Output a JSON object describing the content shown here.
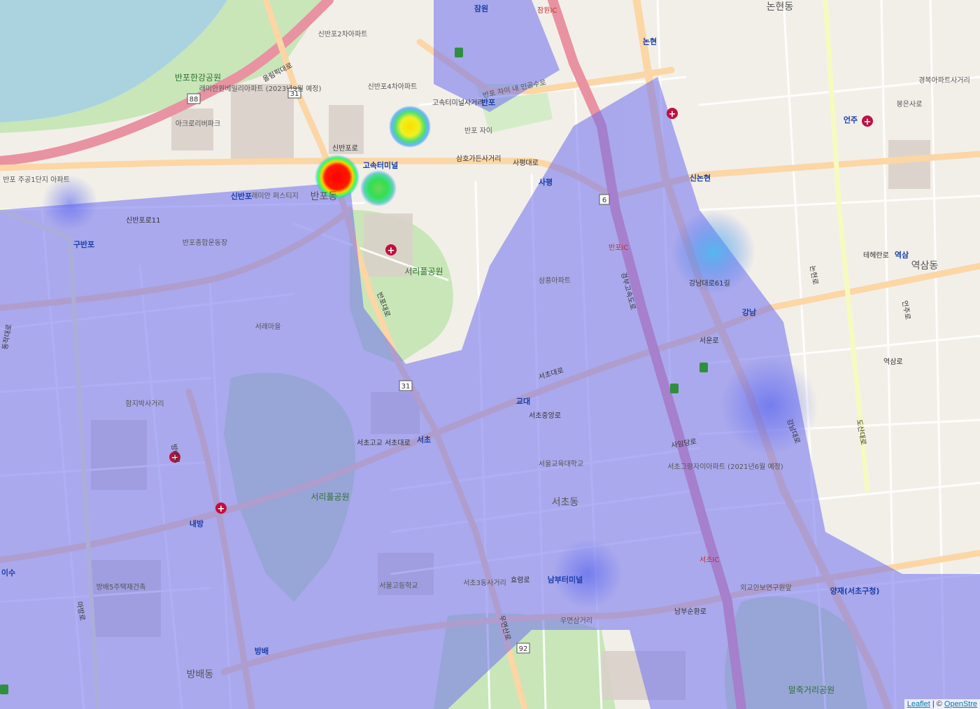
{
  "map": {
    "attribution": {
      "leaflet": "Leaflet",
      "sep": " | © ",
      "osm": "OpenStre"
    },
    "colors": {
      "land": "#f2efe9",
      "water": "#aad3df",
      "park": "#c8e6b8",
      "motorway": "#e892a2",
      "primary": "#fcd6a4",
      "heat_base": "#6f6ff0"
    },
    "area_labels": [
      {
        "id": "banpo-dong",
        "text": "반포동"
      },
      {
        "id": "seocho-dong",
        "text": "서초동"
      },
      {
        "id": "bangbae-dong",
        "text": "방배동"
      },
      {
        "id": "yeoksam-dong",
        "text": "역삼동"
      },
      {
        "id": "nonhyeon-dong",
        "text": "논현동"
      },
      {
        "id": "seoripul-park",
        "text": "서리풀공원"
      },
      {
        "id": "seoripul-park-2",
        "text": "서리풀공원"
      },
      {
        "id": "maljuk-park",
        "text": "말죽거리공원"
      },
      {
        "id": "banpo-hangang-park",
        "text": "반포한강공원"
      },
      {
        "id": "seoul-edu-univ",
        "text": "서울교육대학교"
      }
    ],
    "station_labels": [
      {
        "id": "gosok",
        "text": "고속터미널"
      },
      {
        "id": "sinbanpo",
        "text": "신반포"
      },
      {
        "id": "gubanpo",
        "text": "구반포"
      },
      {
        "id": "banpo",
        "text": "반포"
      },
      {
        "id": "sapyeong",
        "text": "사평"
      },
      {
        "id": "nonhyeon",
        "text": "논현"
      },
      {
        "id": "sinnonhyeon",
        "text": "신논현"
      },
      {
        "id": "gangnam",
        "text": "강남"
      },
      {
        "id": "gyodae",
        "text": "교대"
      },
      {
        "id": "seocho",
        "text": "서초"
      },
      {
        "id": "nambu",
        "text": "남부터미널"
      },
      {
        "id": "bangbae",
        "text": "방배"
      },
      {
        "id": "naebang",
        "text": "내방"
      },
      {
        "id": "isu",
        "text": "이수"
      },
      {
        "id": "eonju",
        "text": "언주"
      },
      {
        "id": "yeoksam",
        "text": "역삼"
      },
      {
        "id": "yangjae",
        "text": "양재(서초구청)"
      },
      {
        "id": "jamwon",
        "text": "잠원"
      }
    ],
    "road_labels": [
      {
        "id": "olympic",
        "text": "올림픽대로"
      },
      {
        "id": "sinbanpo-ro",
        "text": "신반포로"
      },
      {
        "id": "sapyeong-daero",
        "text": "사평대로"
      },
      {
        "id": "banpo-daero",
        "text": "반포대로"
      },
      {
        "id": "seocho-daero",
        "text": "서초대로"
      },
      {
        "id": "gangnam-daero",
        "text": "강남대로"
      },
      {
        "id": "teheran-ro",
        "text": "테헤란로"
      },
      {
        "id": "hyoryeong-ro",
        "text": "효령로"
      },
      {
        "id": "nambusunhwan-ro",
        "text": "남부순환로"
      },
      {
        "id": "bangbae-ro",
        "text": "방배로"
      },
      {
        "id": "gyeongbu",
        "text": "경부고속도로"
      },
      {
        "id": "seocho-jungang",
        "text": "서초중앙로"
      },
      {
        "id": "banpo-ic",
        "text": "반포IC"
      },
      {
        "id": "seocho-ic",
        "text": "서초IC"
      },
      {
        "id": "jamwon-ic",
        "text": "잠원IC"
      },
      {
        "id": "nonhyeon-ro",
        "text": "논현로"
      },
      {
        "id": "eonju-ro",
        "text": "언주로"
      },
      {
        "id": "dosan-daero",
        "text": "도산대로"
      },
      {
        "id": "yeoksam-ro",
        "text": "역삼로"
      },
      {
        "id": "sinbanpo-ro-11",
        "text": "신반포로11"
      },
      {
        "id": "dongjak-daero",
        "text": "동작대로"
      },
      {
        "id": "seoun-ro",
        "text": "서운로"
      },
      {
        "id": "sayeongdang-ro",
        "text": "사임당로"
      },
      {
        "id": "gangnam-daero-61",
        "text": "강남대로61길"
      },
      {
        "id": "seochogyo",
        "text": "서초고교 서초대로"
      },
      {
        "id": "samho",
        "text": "삼호가든사거리"
      },
      {
        "id": "gosok-cross",
        "text": "고속터미널사거리"
      },
      {
        "id": "umyeon",
        "text": "우면산로"
      },
      {
        "id": "mabang",
        "text": "마방로"
      }
    ],
    "poi_labels": [
      {
        "id": "raemian",
        "text": "래미안원베일리아파트 (2023년9월 예정)"
      },
      {
        "id": "acro",
        "text": "아크로리버파크"
      },
      {
        "id": "banpo-jugong",
        "text": "반포 주공1단지 아파트"
      },
      {
        "id": "banpo-xi",
        "text": "반포 자이"
      },
      {
        "id": "seocho-grand",
        "text": "서초그랑자이아파트 (2021년6월 예정)"
      },
      {
        "id": "bangbae5",
        "text": "방배5주택재건축"
      },
      {
        "id": "seoul-high",
        "text": "서울고등학교"
      },
      {
        "id": "raemian-firstige",
        "text": "래미안 퍼스티지"
      },
      {
        "id": "sangdong",
        "text": "삼풍아파트"
      },
      {
        "id": "banpo-sports",
        "text": "반포종합운동장"
      },
      {
        "id": "seorae",
        "text": "서래마을"
      },
      {
        "id": "hamji",
        "text": "함지박사거리"
      },
      {
        "id": "umyeon-cross",
        "text": "우면삼거리"
      },
      {
        "id": "seocho3",
        "text": "서초3동사거리"
      },
      {
        "id": "oegyo",
        "text": "외교안보연구원앞"
      },
      {
        "id": "banpo-chai",
        "text": "반포 자이 내 인공수로"
      },
      {
        "id": "sinbanpo4",
        "text": "신반포4차아파트"
      },
      {
        "id": "sinbanpo2",
        "text": "신반포2차아파트"
      },
      {
        "id": "gyeongbuk",
        "text": "경복아파트사거리"
      },
      {
        "id": "bongeunsa",
        "text": "봉은사로"
      }
    ],
    "shields": [
      {
        "id": "r31a",
        "text": "31"
      },
      {
        "id": "r88",
        "text": "88"
      },
      {
        "id": "r31b",
        "text": "31"
      },
      {
        "id": "r6",
        "text": "6"
      },
      {
        "id": "r92",
        "text": "92"
      }
    ],
    "heatmap": {
      "hotspots": [
        {
          "id": "hot-red",
          "intensity": 1.0
        },
        {
          "id": "hot-green",
          "intensity": 0.6
        },
        {
          "id": "hot-yellow",
          "intensity": 0.8
        }
      ]
    }
  }
}
